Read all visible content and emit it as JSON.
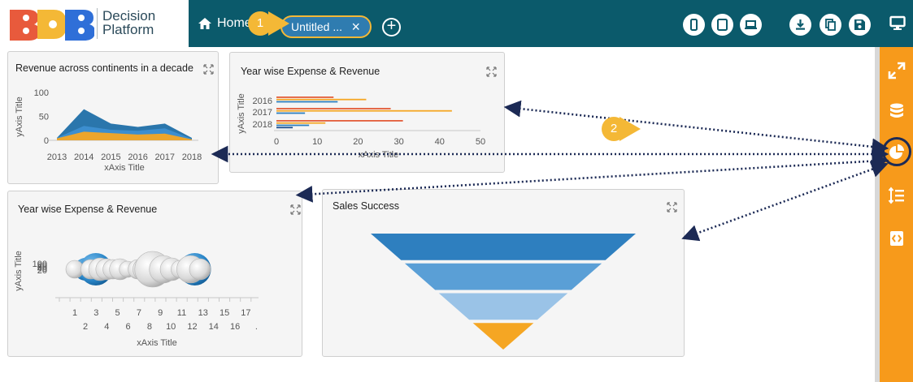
{
  "app": {
    "brand_name_line1": "Decision",
    "brand_name_line2": "Platform",
    "home_label": "Home",
    "tab_label": "Untitled ...",
    "tab_close": "×",
    "add_tab": "+",
    "callout_1": "1",
    "callout_2": "2"
  },
  "toolbar": {
    "buttons": [
      "mobile-preview-icon",
      "tablet-preview-icon",
      "laptop-preview-icon",
      "download-icon",
      "copy-icon",
      "save-icon",
      "monitor-icon"
    ]
  },
  "sidebar": {
    "items": [
      "expand-icon",
      "database-icon",
      "pie-chart-icon",
      "sort-list-icon",
      "script-icon"
    ],
    "active_item": "pie-chart-icon"
  },
  "colors": {
    "topbar": "#0b5a6b",
    "accent": "#f4b836",
    "sidebar": "#f79a1b",
    "series_blue": "#2e7fc0",
    "series_orange": "#f5a623",
    "series_red": "#e35d3a",
    "series_navy": "#1f4e8c"
  },
  "widgets": {
    "area": {
      "title": "Revenue across continents in a decade"
    },
    "bar": {
      "title": "Year wise Expense & Revenue"
    },
    "bubble": {
      "title": "Year wise Expense & Revenue"
    },
    "funnel": {
      "title": "Sales Success"
    }
  },
  "chart_data": [
    {
      "type": "area",
      "title": "Revenue across continents in a decade",
      "xlabel": "xAxis Title",
      "ylabel": "yAxis Title",
      "categories": [
        "2013",
        "2014",
        "2015",
        "2016",
        "2017",
        "2018"
      ],
      "yticks": [
        "0",
        "50",
        "100"
      ],
      "ylim": [
        0,
        100
      ],
      "series": [
        {
          "values": [
            5,
            65,
            35,
            28,
            35,
            5
          ],
          "color": "#1f6fa8"
        },
        {
          "values": [
            5,
            30,
            22,
            20,
            25,
            3
          ],
          "color": "#3d8fd1"
        },
        {
          "values": [
            4,
            18,
            15,
            12,
            14,
            2
          ],
          "color": "#f5a623"
        }
      ]
    },
    {
      "type": "bar",
      "orientation": "horizontal",
      "title": "Year wise Expense & Revenue",
      "xlabel": "xAxis Title",
      "ylabel": "yAxis Title",
      "categories": [
        "2016",
        "2017",
        "2018"
      ],
      "xticks": [
        "0",
        "10",
        "20",
        "30",
        "40",
        "50"
      ],
      "xlim": [
        0,
        50
      ],
      "series": [
        {
          "color": "#e35d3a",
          "values": [
            14,
            28,
            31
          ]
        },
        {
          "color": "#f5a623",
          "values": [
            22,
            43,
            12
          ]
        },
        {
          "color": "#2e7fc0",
          "values": [
            15,
            7,
            8
          ]
        },
        {
          "color": "#1f4e8c",
          "values": [
            0,
            0,
            4
          ]
        }
      ]
    },
    {
      "type": "scatter",
      "subtype": "bubble",
      "title": "Year wise Expense & Revenue",
      "xlabel": "xAxis Title",
      "ylabel": "yAxis Title",
      "xticks_row1": [
        "1",
        "3",
        "5",
        "7",
        "9",
        "11",
        "13",
        "15",
        "17"
      ],
      "xticks_row2": [
        "2",
        "4",
        "6",
        "8",
        "10",
        "12",
        "14",
        "16",
        "."
      ],
      "yticks": [
        "100",
        "80",
        "60",
        "40",
        "20"
      ],
      "points": [
        {
          "x": 1,
          "r": 11,
          "kind": "grey"
        },
        {
          "x": 2,
          "r": 14,
          "kind": "blue"
        },
        {
          "x": 2.5,
          "r": 12,
          "kind": "grey"
        },
        {
          "x": 3,
          "r": 20,
          "kind": "blue"
        },
        {
          "x": 3.4,
          "r": 14,
          "kind": "grey"
        },
        {
          "x": 4,
          "r": 13,
          "kind": "grey"
        },
        {
          "x": 4.6,
          "r": 12,
          "kind": "grey"
        },
        {
          "x": 5.3,
          "r": 13,
          "kind": "grey"
        },
        {
          "x": 6,
          "r": 10,
          "kind": "grey"
        },
        {
          "x": 7,
          "r": 12,
          "kind": "grey"
        },
        {
          "x": 7.6,
          "r": 14,
          "kind": "grey"
        },
        {
          "x": 8.4,
          "r": 22,
          "kind": "grey"
        },
        {
          "x": 9.4,
          "r": 17,
          "kind": "grey"
        },
        {
          "x": 10.2,
          "r": 14,
          "kind": "grey"
        },
        {
          "x": 11,
          "r": 11,
          "kind": "grey"
        },
        {
          "x": 12.4,
          "r": 20,
          "kind": "blue"
        },
        {
          "x": 12.0,
          "r": 17,
          "kind": "grey"
        },
        {
          "x": 12.9,
          "r": 13,
          "kind": "grey"
        }
      ]
    },
    {
      "type": "funnel",
      "title": "Sales Success",
      "levels": [
        {
          "value": 100,
          "color": "#2e7fbf"
        },
        {
          "value": 70,
          "color": "#5a9fd6"
        },
        {
          "value": 45,
          "color": "#9ac3e7"
        },
        {
          "value": 25,
          "color": "#f5a623"
        }
      ]
    }
  ]
}
